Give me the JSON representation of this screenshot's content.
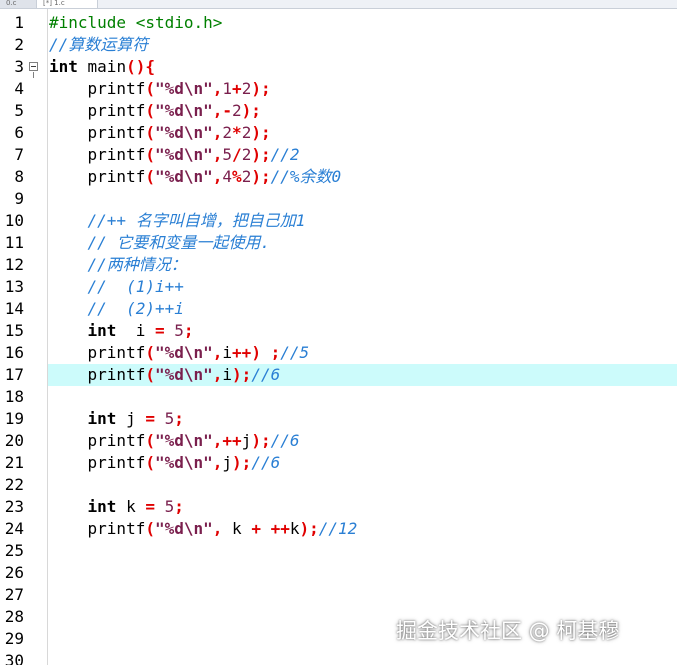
{
  "tabs": [
    "0.c",
    "[*] 1.c"
  ],
  "current_line": 17,
  "fold_line": 3,
  "lines": [
    {
      "n": "1",
      "tokens": [
        [
          "pp",
          "#include <stdio.h>"
        ]
      ]
    },
    {
      "n": "2",
      "tokens": [
        [
          "cm",
          "//算数运算符"
        ]
      ]
    },
    {
      "n": "3",
      "tokens": [
        [
          "kw",
          "int"
        ],
        [
          "plain",
          " main"
        ],
        [
          "op",
          "(){"
        ]
      ]
    },
    {
      "n": "4",
      "tokens": [
        [
          "plain",
          "    printf"
        ],
        [
          "op",
          "("
        ],
        [
          "str",
          "\"%d\\n\""
        ],
        [
          "op",
          ","
        ],
        [
          "num",
          "1"
        ],
        [
          "op",
          "+"
        ],
        [
          "num",
          "2"
        ],
        [
          "op",
          ");"
        ]
      ]
    },
    {
      "n": "5",
      "tokens": [
        [
          "plain",
          "    printf"
        ],
        [
          "op",
          "("
        ],
        [
          "str",
          "\"%d\\n\""
        ],
        [
          "op",
          ",-"
        ],
        [
          "num",
          "2"
        ],
        [
          "op",
          ");"
        ]
      ]
    },
    {
      "n": "6",
      "tokens": [
        [
          "plain",
          "    printf"
        ],
        [
          "op",
          "("
        ],
        [
          "str",
          "\"%d\\n\""
        ],
        [
          "op",
          ","
        ],
        [
          "num",
          "2"
        ],
        [
          "op",
          "*"
        ],
        [
          "num",
          "2"
        ],
        [
          "op",
          ");"
        ]
      ]
    },
    {
      "n": "7",
      "tokens": [
        [
          "plain",
          "    printf"
        ],
        [
          "op",
          "("
        ],
        [
          "str",
          "\"%d\\n\""
        ],
        [
          "op",
          ","
        ],
        [
          "num",
          "5"
        ],
        [
          "op",
          "/"
        ],
        [
          "num",
          "2"
        ],
        [
          "op",
          ");"
        ],
        [
          "cm",
          "//2"
        ]
      ]
    },
    {
      "n": "8",
      "tokens": [
        [
          "plain",
          "    printf"
        ],
        [
          "op",
          "("
        ],
        [
          "str",
          "\"%d\\n\""
        ],
        [
          "op",
          ","
        ],
        [
          "num",
          "4"
        ],
        [
          "op",
          "%"
        ],
        [
          "num",
          "2"
        ],
        [
          "op",
          ");"
        ],
        [
          "cm",
          "//%余数0"
        ]
      ]
    },
    {
      "n": "9",
      "tokens": []
    },
    {
      "n": "10",
      "tokens": [
        [
          "cm",
          "    //++ 名字叫自增，把自己加1"
        ]
      ]
    },
    {
      "n": "11",
      "tokens": [
        [
          "cm",
          "    // 它要和变量一起使用."
        ]
      ]
    },
    {
      "n": "12",
      "tokens": [
        [
          "cm",
          "    //两种情况："
        ]
      ]
    },
    {
      "n": "13",
      "tokens": [
        [
          "cm",
          "    //  (1)i++"
        ]
      ]
    },
    {
      "n": "14",
      "tokens": [
        [
          "cm",
          "    //  (2)++i"
        ]
      ]
    },
    {
      "n": "15",
      "tokens": [
        [
          "plain",
          "    "
        ],
        [
          "kw",
          "int"
        ],
        [
          "plain",
          "  i "
        ],
        [
          "op",
          "="
        ],
        [
          "plain",
          " "
        ],
        [
          "num",
          "5"
        ],
        [
          "op",
          ";"
        ]
      ]
    },
    {
      "n": "16",
      "tokens": [
        [
          "plain",
          "    printf"
        ],
        [
          "op",
          "("
        ],
        [
          "str",
          "\"%d\\n\""
        ],
        [
          "op",
          ","
        ],
        [
          "plain",
          "i"
        ],
        [
          "op",
          "++)"
        ],
        [
          "plain",
          " "
        ],
        [
          "op",
          ";"
        ],
        [
          "cm",
          "//5"
        ]
      ]
    },
    {
      "n": "17",
      "tokens": [
        [
          "plain",
          "    printf"
        ],
        [
          "op",
          "("
        ],
        [
          "str",
          "\"%d\\n\""
        ],
        [
          "op",
          ","
        ],
        [
          "plain",
          "i"
        ],
        [
          "op",
          ");"
        ],
        [
          "cm",
          "//6"
        ]
      ]
    },
    {
      "n": "18",
      "tokens": []
    },
    {
      "n": "19",
      "tokens": [
        [
          "plain",
          "    "
        ],
        [
          "kw",
          "int"
        ],
        [
          "plain",
          " j "
        ],
        [
          "op",
          "="
        ],
        [
          "plain",
          " "
        ],
        [
          "num",
          "5"
        ],
        [
          "op",
          ";"
        ]
      ]
    },
    {
      "n": "20",
      "tokens": [
        [
          "plain",
          "    printf"
        ],
        [
          "op",
          "("
        ],
        [
          "str",
          "\"%d\\n\""
        ],
        [
          "op",
          ",++"
        ],
        [
          "plain",
          "j"
        ],
        [
          "op",
          ");"
        ],
        [
          "cm",
          "//6"
        ]
      ]
    },
    {
      "n": "21",
      "tokens": [
        [
          "plain",
          "    printf"
        ],
        [
          "op",
          "("
        ],
        [
          "str",
          "\"%d\\n\""
        ],
        [
          "op",
          ","
        ],
        [
          "plain",
          "j"
        ],
        [
          "op",
          ");"
        ],
        [
          "cm",
          "//6"
        ]
      ]
    },
    {
      "n": "22",
      "tokens": []
    },
    {
      "n": "23",
      "tokens": [
        [
          "plain",
          "    "
        ],
        [
          "kw",
          "int"
        ],
        [
          "plain",
          " k "
        ],
        [
          "op",
          "="
        ],
        [
          "plain",
          " "
        ],
        [
          "num",
          "5"
        ],
        [
          "op",
          ";"
        ]
      ]
    },
    {
      "n": "24",
      "tokens": [
        [
          "plain",
          "    printf"
        ],
        [
          "op",
          "("
        ],
        [
          "str",
          "\"%d\\n\""
        ],
        [
          "op",
          ","
        ],
        [
          "plain",
          " k "
        ],
        [
          "op",
          "+"
        ],
        [
          "plain",
          " "
        ],
        [
          "op",
          "++"
        ],
        [
          "plain",
          "k"
        ],
        [
          "op",
          ");"
        ],
        [
          "cm",
          "//12"
        ]
      ]
    },
    {
      "n": "25",
      "tokens": []
    },
    {
      "n": "26",
      "tokens": []
    },
    {
      "n": "27",
      "tokens": []
    },
    {
      "n": "28",
      "tokens": []
    },
    {
      "n": "29",
      "tokens": []
    },
    {
      "n": "30",
      "tokens": []
    }
  ],
  "watermark": "掘金技术社区 @ 柯基穆",
  "colors": {
    "current_line_bg": "#ccfbfb",
    "comment": "#2a7fd4",
    "preprocessor": "#008000",
    "operator": "#e00000",
    "string": "#7a1f4d",
    "number": "#7a1f4d"
  }
}
